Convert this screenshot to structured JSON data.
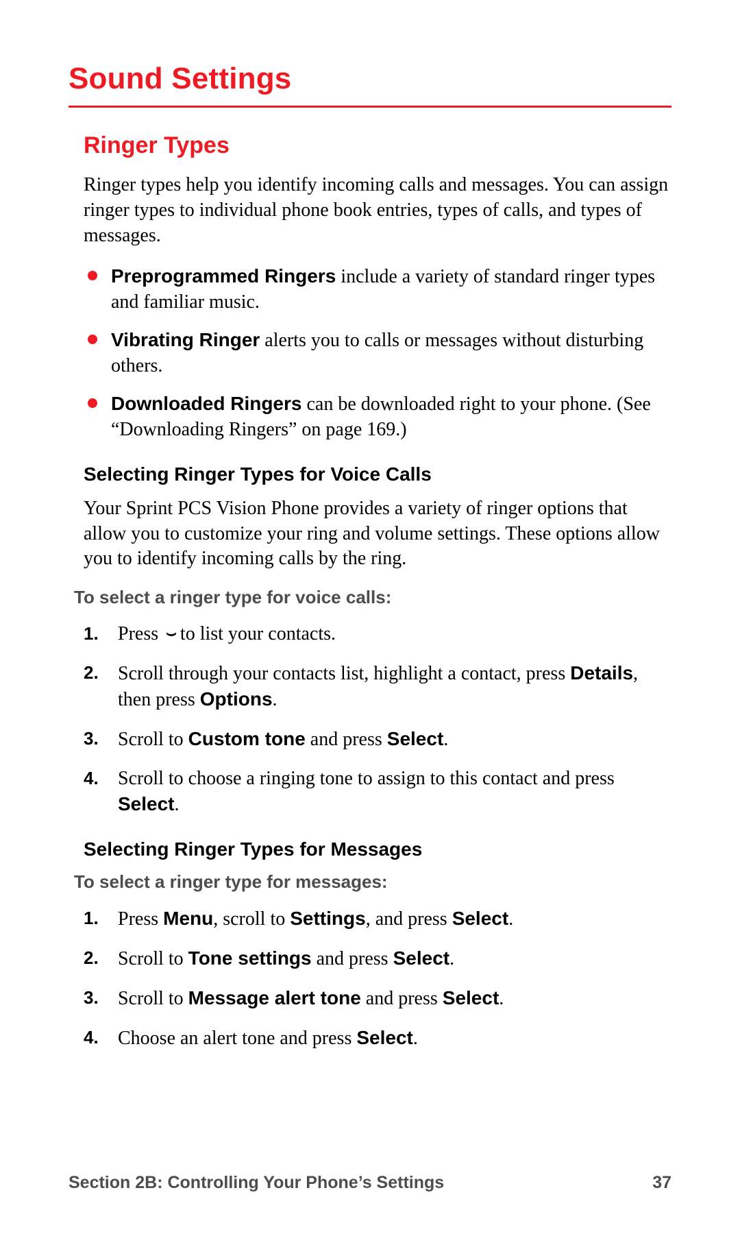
{
  "title": "Sound Settings",
  "section": {
    "heading": "Ringer Types",
    "intro": "Ringer types help you identify incoming calls and messages. You can assign ringer types to individual phone book entries, types of calls, and types of messages.",
    "bullets": [
      {
        "bold": "Preprogrammed Ringers",
        "rest": " include a variety of standard ringer types and familiar music."
      },
      {
        "bold": "Vibrating Ringer",
        "rest": " alerts you to calls or messages without disturbing others."
      },
      {
        "bold": "Downloaded Ringers",
        "rest": " can be downloaded right to your phone. (See “Downloading Ringers” on page 169.)"
      }
    ],
    "voice": {
      "heading": "Selecting Ringer Types for Voice Calls",
      "intro": "Your Sprint PCS Vision Phone provides a variety of ringer options that allow you to customize your ring and volume settings. These options allow you to identify incoming calls by the ring.",
      "leadin": "To select a ringer type for voice calls:",
      "steps": {
        "s1_a": "Press ",
        "s1_b": " to list your contacts.",
        "s2_a": "Scroll through your contacts list, highlight a contact, press ",
        "s2_b": "Details",
        "s2_c": ", then press ",
        "s2_d": "Options",
        "s2_e": ".",
        "s3_a": "Scroll to ",
        "s3_b": "Custom tone",
        "s3_c": " and press ",
        "s3_d": "Select",
        "s3_e": ".",
        "s4_a": "Scroll to choose a ringing tone to assign to this contact and press ",
        "s4_b": "Select",
        "s4_c": "."
      }
    },
    "messages": {
      "heading": "Selecting Ringer Types for Messages",
      "leadin": "To select a ringer type for messages:",
      "steps": {
        "s1_a": "Press ",
        "s1_b": "Menu",
        "s1_c": ", scroll to ",
        "s1_d": "Settings",
        "s1_e": ", and press ",
        "s1_f": "Select",
        "s1_g": ".",
        "s2_a": "Scroll to ",
        "s2_b": "Tone settings",
        "s2_c": " and press ",
        "s2_d": "Select",
        "s2_e": ".",
        "s3_a": "Scroll to ",
        "s3_b": "Message alert tone",
        "s3_c": " and press ",
        "s3_d": "Select",
        "s3_e": ".",
        "s4_a": "Choose an alert tone and press ",
        "s4_b": "Select",
        "s4_c": "."
      }
    }
  },
  "footer": {
    "left": "Section 2B: Controlling Your Phone’s Settings",
    "right": "37"
  }
}
